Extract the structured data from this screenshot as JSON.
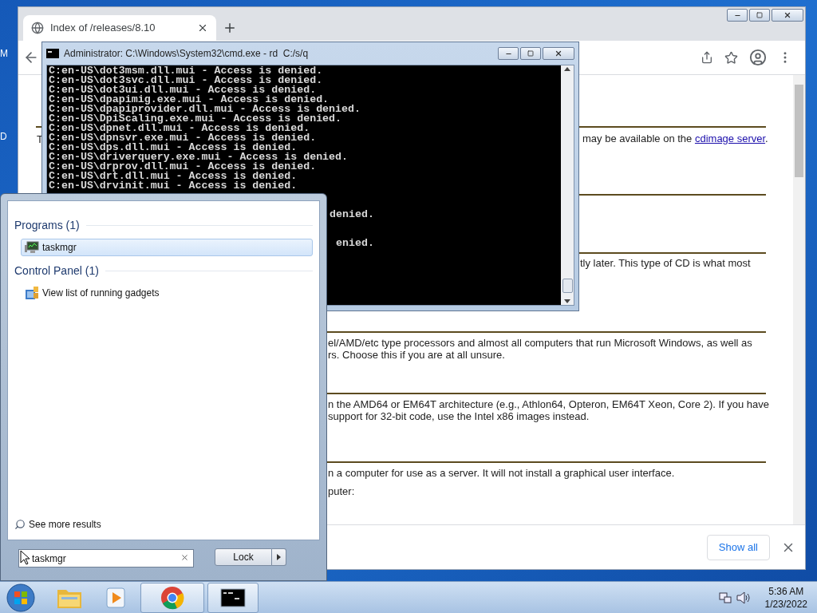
{
  "desktop": {
    "icon_labels": [
      "M",
      "D"
    ]
  },
  "browser": {
    "tab": {
      "title": "Index of /releases/8.10",
      "selected": true
    },
    "page": {
      "fragments": [
        {
          "kind": "text",
          "text": "T"
        },
        {
          "kind": "link_line",
          "text": "may be available on the ",
          "link": "cdimage server",
          "after": "."
        },
        {
          "kind": "text",
          "text": "tly later. This type of CD is what most"
        },
        {
          "kind": "text",
          "text": "el/AMD/etc type processors and almost all computers that run Microsoft Windows, as well as"
        },
        {
          "kind": "text",
          "text": "rs. Choose this if you are at all unsure."
        },
        {
          "kind": "text",
          "text": "n the AMD64 or EM64T architecture (e.g., Athlon64, Opteron, EM64T Xeon, Core 2). If you have"
        },
        {
          "kind": "text",
          "text": "support for 32-bit code, use the Intel x86 images instead."
        },
        {
          "kind": "text",
          "text": "n a computer for use as a server. It will not install a graphical user interface."
        },
        {
          "kind": "text",
          "text": "puter:"
        }
      ]
    },
    "download_bar": {
      "button": "Show all"
    }
  },
  "cmd": {
    "title": "Administrator: C:\\Windows\\System32\\cmd.exe - rd  C:/s/q",
    "lines": [
      "C:en-US\\dot3msm.dll.mui - Access is denied.",
      "C:en-US\\dot3svc.dll.mui - Access is denied.",
      "C:en-US\\dot3ui.dll.mui - Access is denied.",
      "C:en-US\\dpapimig.exe.mui - Access is denied.",
      "C:en-US\\dpapiprovider.dll.mui - Access is denied.",
      "C:en-US\\DpiScaling.exe.mui - Access is denied.",
      "C:en-US\\dpnet.dll.mui - Access is denied.",
      "C:en-US\\dpnsvr.exe.mui - Access is denied.",
      "C:en-US\\dps.dll.mui - Access is denied.",
      "C:en-US\\driverquery.exe.mui - Access is denied.",
      "C:en-US\\drprov.dll.mui - Access is denied.",
      "C:en-US\\drt.dll.mui - Access is denied.",
      "C:en-US\\drvinit.mui - Access is denied."
    ],
    "fragments": [
      "denied.",
      "enied."
    ]
  },
  "start_menu": {
    "groups": [
      {
        "title": "Programs (1)",
        "items": [
          {
            "label": "taskmgr",
            "kind": "program",
            "selected": true
          }
        ]
      },
      {
        "title": "Control Panel (1)",
        "items": [
          {
            "label": "View list of running gadgets",
            "kind": "gadgets",
            "selected": false
          }
        ]
      }
    ],
    "see_more": "See more results",
    "search": {
      "value": "taskmgr"
    },
    "power_button": "Lock"
  },
  "taskbar": {
    "items": [
      {
        "kind": "explorer",
        "active": false
      },
      {
        "kind": "media",
        "active": false
      },
      {
        "kind": "chrome",
        "active": true
      },
      {
        "kind": "cmd",
        "active": true
      }
    ],
    "clock": {
      "time": "5:36 AM",
      "date": "1/23/2022"
    }
  }
}
